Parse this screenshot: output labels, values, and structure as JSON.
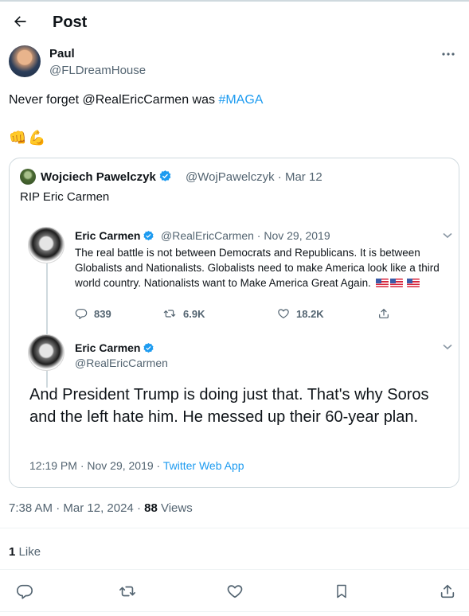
{
  "header": {
    "title": "Post"
  },
  "post": {
    "author": {
      "name": "Paul",
      "handle": "@FLDreamHouse"
    },
    "text_prefix": "Never forget @RealEricCarmen was ",
    "hashtag": "#MAGA",
    "emojis": [
      "👊",
      "💪"
    ],
    "time": "7:38 AM",
    "date": "Mar 12, 2024",
    "views_count": "88",
    "views_label": "Views",
    "likes_count": "1",
    "likes_label": "Like"
  },
  "quote": {
    "author": {
      "name": "Wojciech Pawelczyk",
      "handle_date": "@WojPawelczyk · Mar 12"
    },
    "text": "RIP Eric Carmen",
    "embed": {
      "first": {
        "name": "Eric Carmen",
        "handle_date": "@RealEricCarmen · Nov 29, 2019",
        "text": "The real battle is not between Democrats and Republicans. It is between Globalists and Nationalists. Globalists need to make America look like a third world country. Nationalists want to Make America Great Again.",
        "replies": "839",
        "retweets": "6.9K",
        "likes": "18.2K"
      },
      "second": {
        "name": "Eric Carmen",
        "handle": "@RealEricCarmen",
        "text": "And President Trump is doing just that. That's why Soros and the left hate him. He messed up their 60-year plan.",
        "timestamp": "12:19 PM · Nov 29, 2019 · ",
        "app": "Twitter Web App"
      }
    }
  },
  "colors": {
    "accent": "#1d9bf0",
    "text": "#0f1419",
    "secondary": "#536471",
    "border": "#cfd9de"
  }
}
